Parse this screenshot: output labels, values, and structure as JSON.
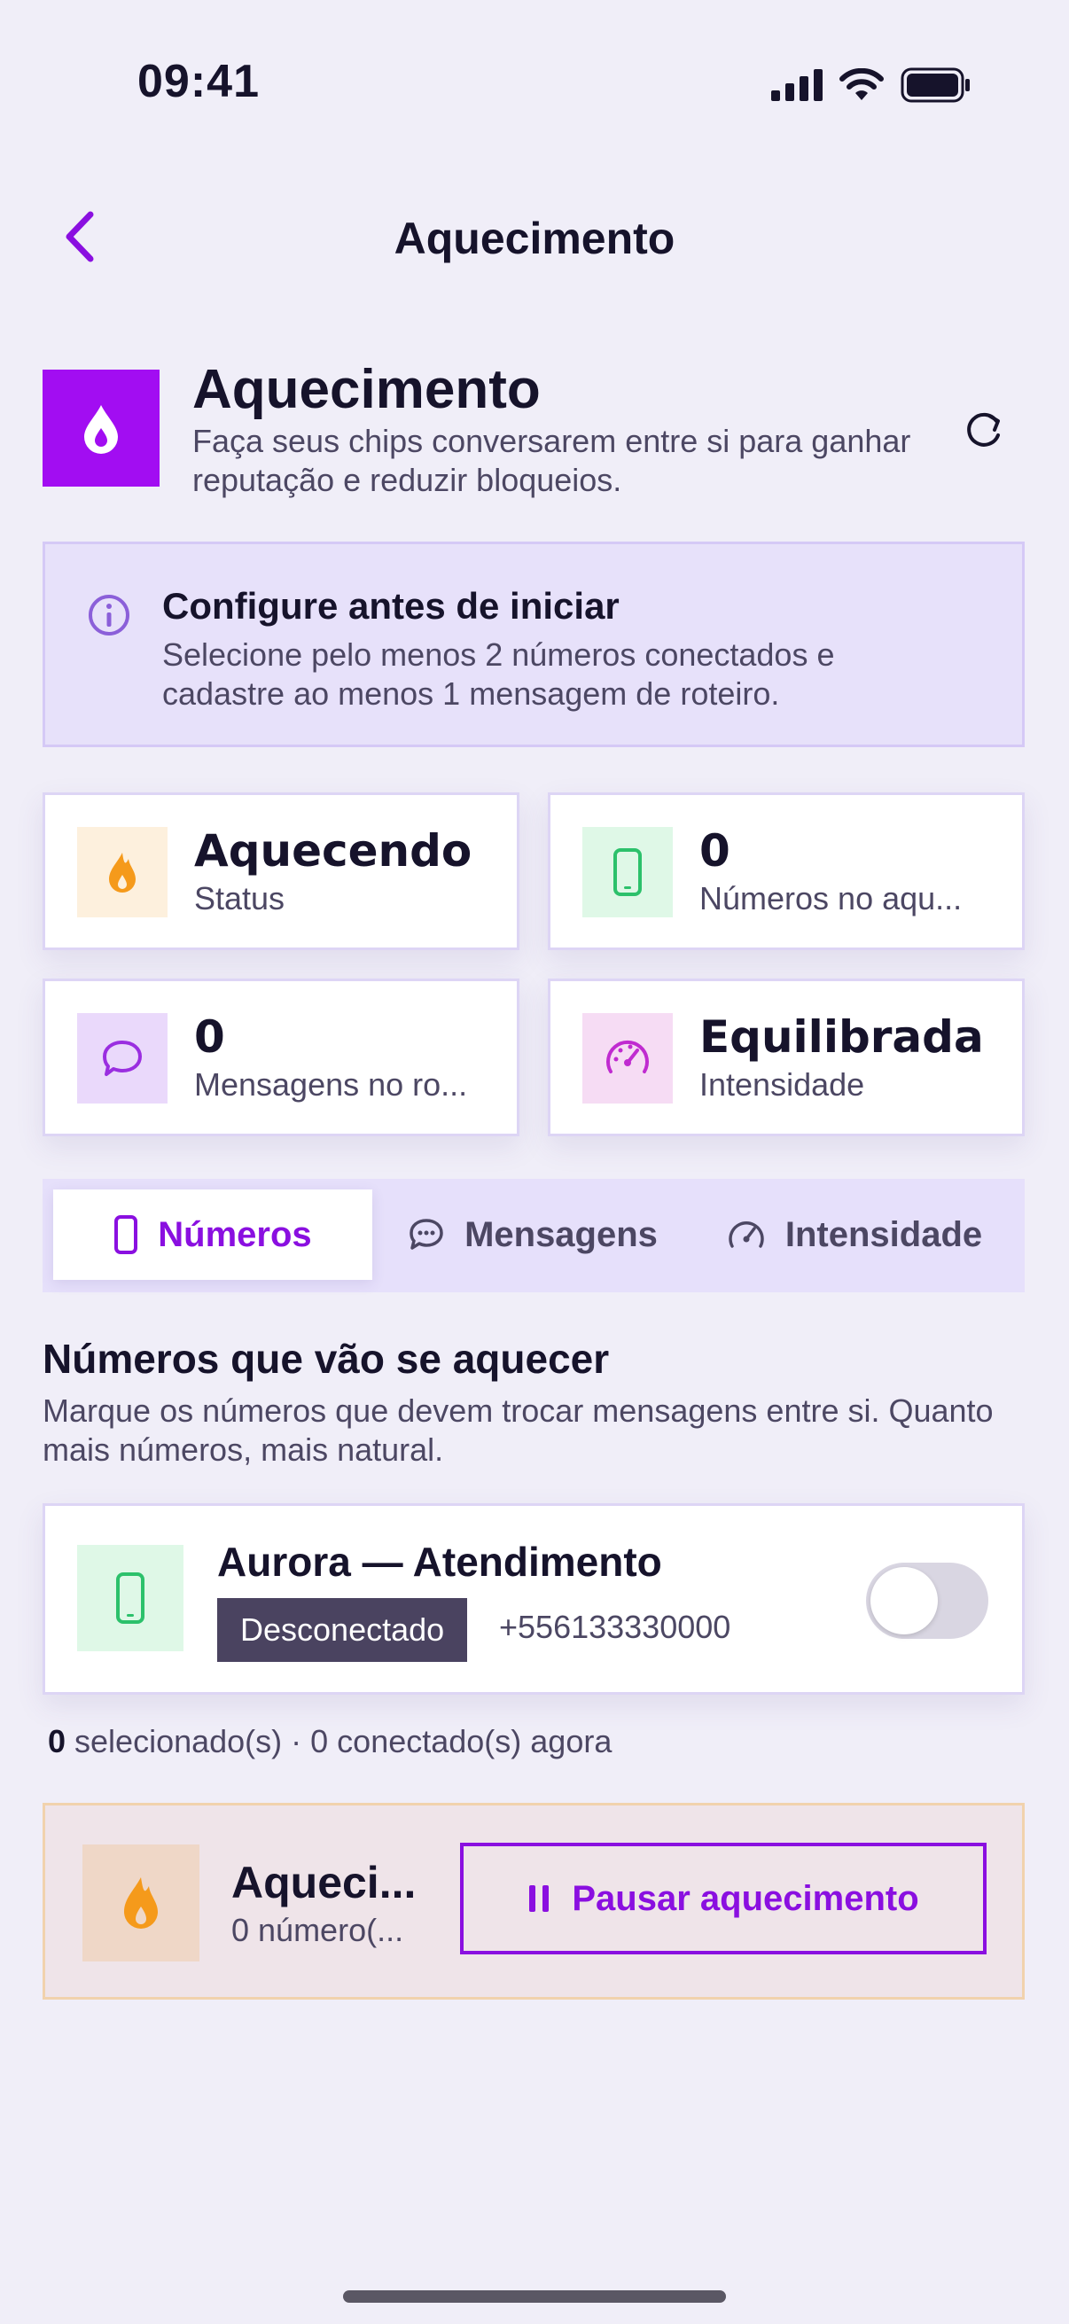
{
  "status_bar": {
    "time": "09:41"
  },
  "nav": {
    "title": "Aquecimento",
    "back_icon": "chevron-left-icon"
  },
  "hero": {
    "icon": "flame-drop-icon",
    "title": "Aquecimento",
    "subtitle": "Faça seus chips conversarem entre si para ganhar reputação e reduzir bloqueios.",
    "refresh_icon": "refresh-icon"
  },
  "info": {
    "title": "Configure antes de iniciar",
    "text": "Selecione pelo menos 2 números conectados e cadastre ao menos 1 mensagem de roteiro."
  },
  "stats": [
    {
      "value": "Aquecendo",
      "label": "Status",
      "icon": "flame-icon"
    },
    {
      "value": "0",
      "label": "Números no aqu...",
      "icon": "phone-icon"
    },
    {
      "value": "0",
      "label": "Mensagens no ro...",
      "icon": "chat-icon"
    },
    {
      "value": "Equilibrada",
      "label": "Intensidade",
      "icon": "gauge-icon"
    }
  ],
  "tabs": [
    {
      "label": "Números",
      "icon": "phone-icon",
      "active": true
    },
    {
      "label": "Mensagens",
      "icon": "chat-icon",
      "active": false
    },
    {
      "label": "Intensidade",
      "icon": "gauge-icon",
      "active": false
    }
  ],
  "section": {
    "title": "Números que vão se aquecer",
    "subtitle": "Marque os números que devem trocar mensagens entre si. Quanto mais números, mais natural."
  },
  "numbers": [
    {
      "name": "Aurora — Atendimento",
      "status": "Desconectado",
      "phone": "+556133330000",
      "selected": false
    }
  ],
  "selection": {
    "count": "0",
    "text": " selecionado(s) · 0 conectado(s) agora"
  },
  "bottom": {
    "title": "Aqueci...",
    "subtitle": "0 número(...",
    "button_label": "Pausar aquecimento"
  },
  "colors": {
    "accent": "#8a0fe0",
    "hero_icon_bg": "#a20df2",
    "background": "#f0eef8",
    "status_badge": "#4a4360"
  }
}
